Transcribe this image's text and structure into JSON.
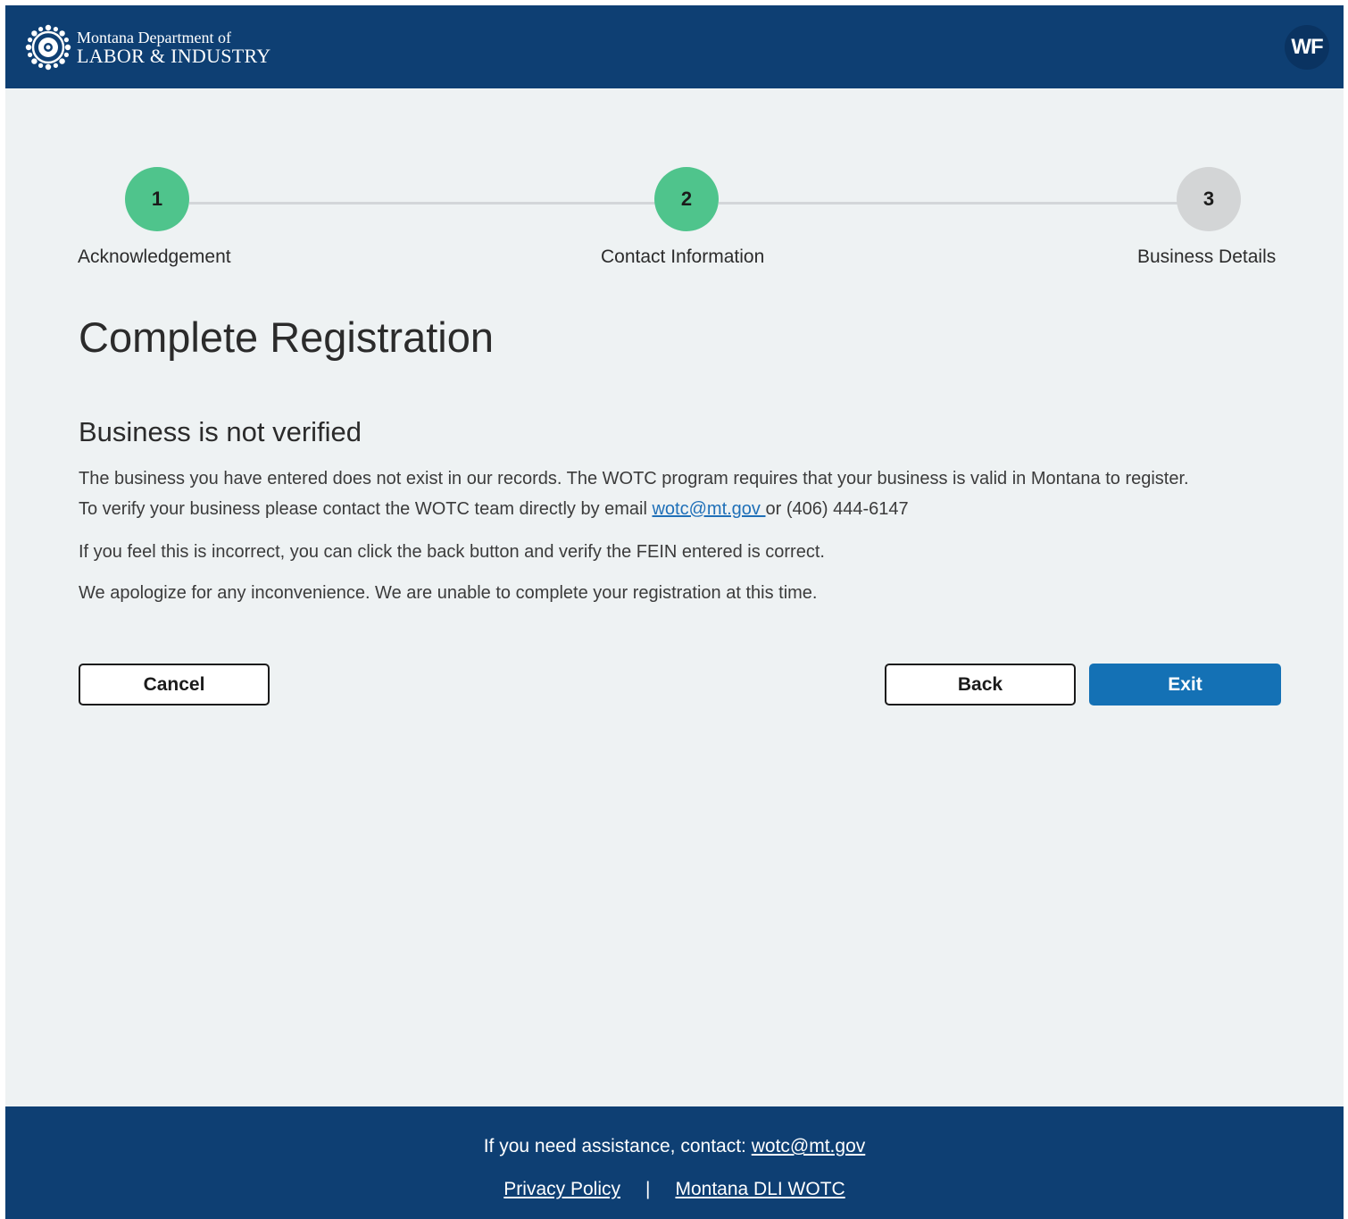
{
  "header": {
    "logo_line1": "Montana Department of",
    "logo_line2": "LABOR & INDUSTRY",
    "avatar_initials": "WF",
    "logo_icon": "gear-seal-icon"
  },
  "stepper": {
    "steps": [
      {
        "number": "1",
        "label": "Acknowledgement",
        "status": "complete"
      },
      {
        "number": "2",
        "label": "Contact Information",
        "status": "complete"
      },
      {
        "number": "3",
        "label": "Business Details",
        "status": "incomplete"
      }
    ]
  },
  "main": {
    "title": "Complete Registration",
    "section_title": "Business is not verified",
    "para1_line1": "The business you have entered does not exist in our records. The WOTC program requires that your business is valid in Montana to register.",
    "para1_line2_prefix": "To verify your business please contact the WOTC team directly by email ",
    "para1_email": "wotc@mt.gov ",
    "para1_suffix": "or (406) 444-6147",
    "para2": "If you feel this is incorrect, you can click the back button and verify the FEIN entered is correct.",
    "para3": "We apologize for any inconvenience. We are unable to complete your registration at this time."
  },
  "buttons": {
    "cancel": "Cancel",
    "back": "Back",
    "exit": "Exit"
  },
  "footer": {
    "help_text": "If you need assistance, contact: ",
    "help_email": "wotc@mt.gov",
    "privacy": "Privacy Policy",
    "separator": "|",
    "dli_link": "Montana DLI WOTC"
  },
  "colors": {
    "header_bg": "#0e3f73",
    "step_complete": "#4fc48c",
    "step_incomplete": "#d3d5d6",
    "primary_button": "#1471b5",
    "link": "#1f70b8",
    "page_bg": "#eef2f3"
  }
}
